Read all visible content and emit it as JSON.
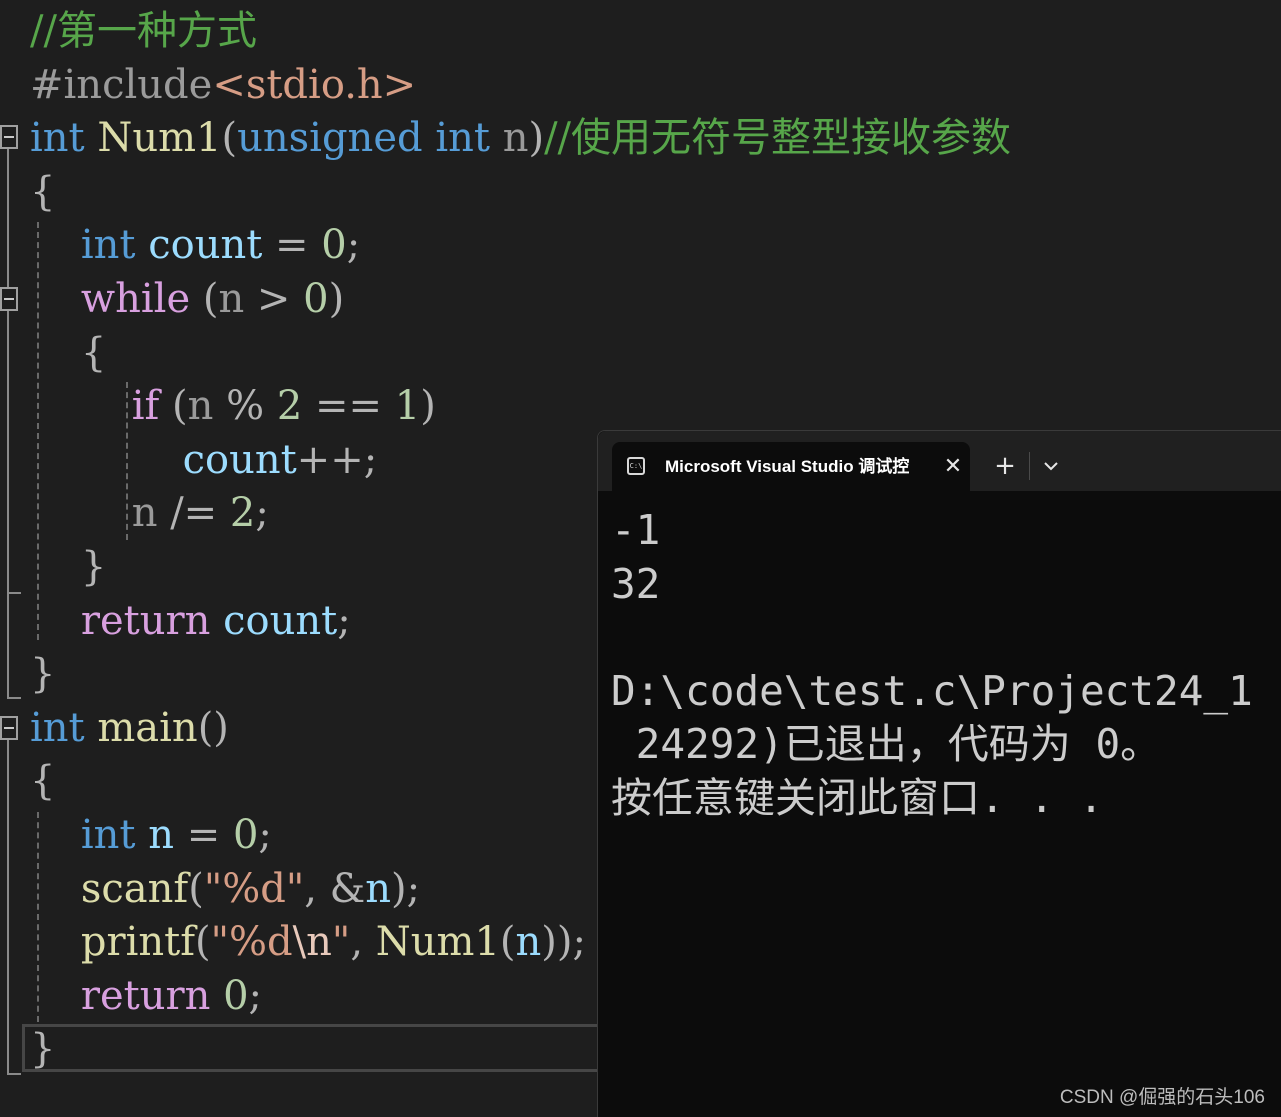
{
  "editor": {
    "lines": [
      [
        {
          "t": "//第一种方式",
          "c": "comment"
        }
      ],
      [
        {
          "t": "#include",
          "c": "pre"
        },
        {
          "t": "<stdio.h>",
          "c": "inc"
        }
      ],
      [
        {
          "t": "int",
          "c": "kw"
        },
        {
          "t": " ",
          "c": "punct"
        },
        {
          "t": "Num1",
          "c": "fn"
        },
        {
          "t": "(",
          "c": "punct"
        },
        {
          "t": "unsigned",
          "c": "kw"
        },
        {
          "t": " ",
          "c": "punct"
        },
        {
          "t": "int",
          "c": "kw"
        },
        {
          "t": " ",
          "c": "punct"
        },
        {
          "t": "n",
          "c": "param"
        },
        {
          "t": ")",
          "c": "punct"
        },
        {
          "t": "//使用无符号整型接收参数",
          "c": "comment"
        }
      ],
      [
        {
          "t": "{",
          "c": "punct"
        }
      ],
      [
        {
          "t": "    ",
          "c": "punct"
        },
        {
          "t": "int",
          "c": "kw"
        },
        {
          "t": " ",
          "c": "punct"
        },
        {
          "t": "count",
          "c": "var"
        },
        {
          "t": " = ",
          "c": "punct"
        },
        {
          "t": "0",
          "c": "num"
        },
        {
          "t": ";",
          "c": "punct"
        }
      ],
      [
        {
          "t": "    ",
          "c": "punct"
        },
        {
          "t": "while",
          "c": "ctl"
        },
        {
          "t": " (",
          "c": "punct"
        },
        {
          "t": "n",
          "c": "param"
        },
        {
          "t": " > ",
          "c": "punct"
        },
        {
          "t": "0",
          "c": "num"
        },
        {
          "t": ")",
          "c": "punct"
        }
      ],
      [
        {
          "t": "    {",
          "c": "punct"
        }
      ],
      [
        {
          "t": "        ",
          "c": "punct"
        },
        {
          "t": "if",
          "c": "ctl"
        },
        {
          "t": " (",
          "c": "punct"
        },
        {
          "t": "n",
          "c": "param"
        },
        {
          "t": " % ",
          "c": "punct"
        },
        {
          "t": "2",
          "c": "num"
        },
        {
          "t": " == ",
          "c": "punct"
        },
        {
          "t": "1",
          "c": "num"
        },
        {
          "t": ")",
          "c": "punct"
        }
      ],
      [
        {
          "t": "            ",
          "c": "punct"
        },
        {
          "t": "count",
          "c": "var"
        },
        {
          "t": "++;",
          "c": "punct"
        }
      ],
      [
        {
          "t": "        ",
          "c": "punct"
        },
        {
          "t": "n",
          "c": "param"
        },
        {
          "t": " /= ",
          "c": "punct"
        },
        {
          "t": "2",
          "c": "num"
        },
        {
          "t": ";",
          "c": "punct"
        }
      ],
      [
        {
          "t": "    }",
          "c": "punct"
        }
      ],
      [
        {
          "t": "    ",
          "c": "punct"
        },
        {
          "t": "return",
          "c": "ctl"
        },
        {
          "t": " ",
          "c": "punct"
        },
        {
          "t": "count",
          "c": "var"
        },
        {
          "t": ";",
          "c": "punct"
        }
      ],
      [
        {
          "t": "}",
          "c": "punct"
        }
      ],
      [
        {
          "t": "int",
          "c": "kw"
        },
        {
          "t": " ",
          "c": "punct"
        },
        {
          "t": "main",
          "c": "fn"
        },
        {
          "t": "()",
          "c": "punct"
        }
      ],
      [
        {
          "t": "{",
          "c": "punct"
        }
      ],
      [
        {
          "t": "    ",
          "c": "punct"
        },
        {
          "t": "int",
          "c": "kw"
        },
        {
          "t": " ",
          "c": "punct"
        },
        {
          "t": "n",
          "c": "var"
        },
        {
          "t": " = ",
          "c": "punct"
        },
        {
          "t": "0",
          "c": "num"
        },
        {
          "t": ";",
          "c": "punct"
        }
      ],
      [
        {
          "t": "    ",
          "c": "punct"
        },
        {
          "t": "scanf",
          "c": "fn"
        },
        {
          "t": "(",
          "c": "punct"
        },
        {
          "t": "\"%d\"",
          "c": "str"
        },
        {
          "t": ", &",
          "c": "punct"
        },
        {
          "t": "n",
          "c": "var"
        },
        {
          "t": ");",
          "c": "punct"
        }
      ],
      [
        {
          "t": "    ",
          "c": "punct"
        },
        {
          "t": "printf",
          "c": "fn"
        },
        {
          "t": "(",
          "c": "punct"
        },
        {
          "t": "\"%d",
          "c": "str"
        },
        {
          "t": "\\n",
          "c": "esc"
        },
        {
          "t": "\"",
          "c": "str"
        },
        {
          "t": ", ",
          "c": "punct"
        },
        {
          "t": "Num1",
          "c": "fn"
        },
        {
          "t": "(",
          "c": "punct"
        },
        {
          "t": "n",
          "c": "var"
        },
        {
          "t": "));",
          "c": "punct"
        }
      ],
      [
        {
          "t": "    ",
          "c": "punct"
        },
        {
          "t": "return",
          "c": "ctl"
        },
        {
          "t": " ",
          "c": "punct"
        },
        {
          "t": "0",
          "c": "num"
        },
        {
          "t": ";",
          "c": "punct"
        }
      ],
      [
        {
          "t": "}",
          "c": "punct"
        }
      ]
    ],
    "colors": {
      "background": "#1e1e1e",
      "comment": "#57a64a",
      "keyword": "#569cd6",
      "control": "#d8a0df",
      "function": "#dcdcaa",
      "variable": "#9cdcfe",
      "number": "#b5cea8",
      "string": "#d69d85"
    }
  },
  "console": {
    "tab_icon": "terminal-icon",
    "tab_icon_text": "C:\\",
    "tab_title": "Microsoft Visual Studio 调试控制台",
    "close_icon": "close-icon",
    "new_tab_icon": "plus-icon",
    "dropdown_icon": "chevron-down-icon",
    "output_lines": [
      "-1",
      "32",
      "",
      "D:\\code\\test.c\\Project24_1",
      " 24292)已退出，代码为 0。",
      "按任意键关闭此窗口. . ."
    ],
    "colors": {
      "background": "#0c0c0c",
      "titlebar": "#202020",
      "text": "#cccccc"
    }
  },
  "watermark": "CSDN @倔强的石头106"
}
